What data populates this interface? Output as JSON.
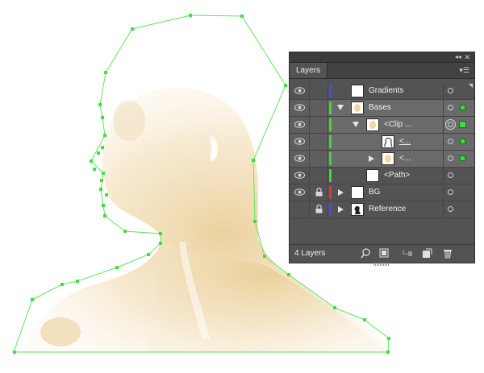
{
  "panel": {
    "tab_label": "Layers",
    "collapse_icon": "double-chevron-left-icon",
    "close_icon": "close-icon",
    "menu_icon": "panel-menu-icon",
    "footer": {
      "count_label": "4 Layers",
      "icons": [
        "locate-object-icon",
        "make-clipping-mask-icon",
        "create-sublayer-icon",
        "create-layer-icon",
        "delete-icon"
      ]
    },
    "rows": [
      {
        "name": "Gradients",
        "visible": true,
        "locked": false,
        "color": "#4b4bdc",
        "indent": 0,
        "expander": "none",
        "thumb": "white",
        "targeted": false,
        "selected": false,
        "underline": false,
        "corner": true
      },
      {
        "name": "Bases",
        "visible": true,
        "locked": false,
        "color": "#3fd63f",
        "indent": 0,
        "expander": "down",
        "thumb": "beige",
        "targeted": false,
        "selected": true,
        "underline": false,
        "corner": false
      },
      {
        "name": "<Clip ...",
        "visible": true,
        "locked": false,
        "color": "#3fd63f",
        "indent": 1,
        "expander": "down",
        "thumb": "beige",
        "targeted": true,
        "selected": true,
        "underline": false,
        "corner": false
      },
      {
        "name": "<...",
        "visible": true,
        "locked": false,
        "color": "#3fd63f",
        "indent": 2,
        "expander": "none",
        "thumb": "head-outline",
        "targeted": false,
        "selected": true,
        "underline": true,
        "corner": false
      },
      {
        "name": "<...",
        "visible": true,
        "locked": false,
        "color": "#3fd63f",
        "indent": 2,
        "expander": "right",
        "thumb": "beige",
        "targeted": false,
        "selected": true,
        "underline": false,
        "corner": false
      },
      {
        "name": "<Path>",
        "visible": true,
        "locked": false,
        "color": "#3fd63f",
        "indent": 1,
        "expander": "none",
        "thumb": "white",
        "targeted": false,
        "selected": false,
        "underline": false,
        "corner": false
      },
      {
        "name": "BG",
        "visible": true,
        "locked": true,
        "color": "#d83a3a",
        "indent": 0,
        "expander": "right",
        "thumb": "white",
        "targeted": false,
        "selected": false,
        "underline": false,
        "corner": false
      },
      {
        "name": "Reference",
        "visible": false,
        "locked": true,
        "color": "#4b4bdc",
        "indent": 0,
        "expander": "right",
        "thumb": "portrait",
        "targeted": false,
        "selected": false,
        "underline": false,
        "corner": false
      }
    ]
  },
  "colors": {
    "path_stroke": "#5ce65c",
    "anchor_fill": "#3ee03e",
    "skin_tone": "#efd6a6",
    "panel_bg": "#535353"
  }
}
